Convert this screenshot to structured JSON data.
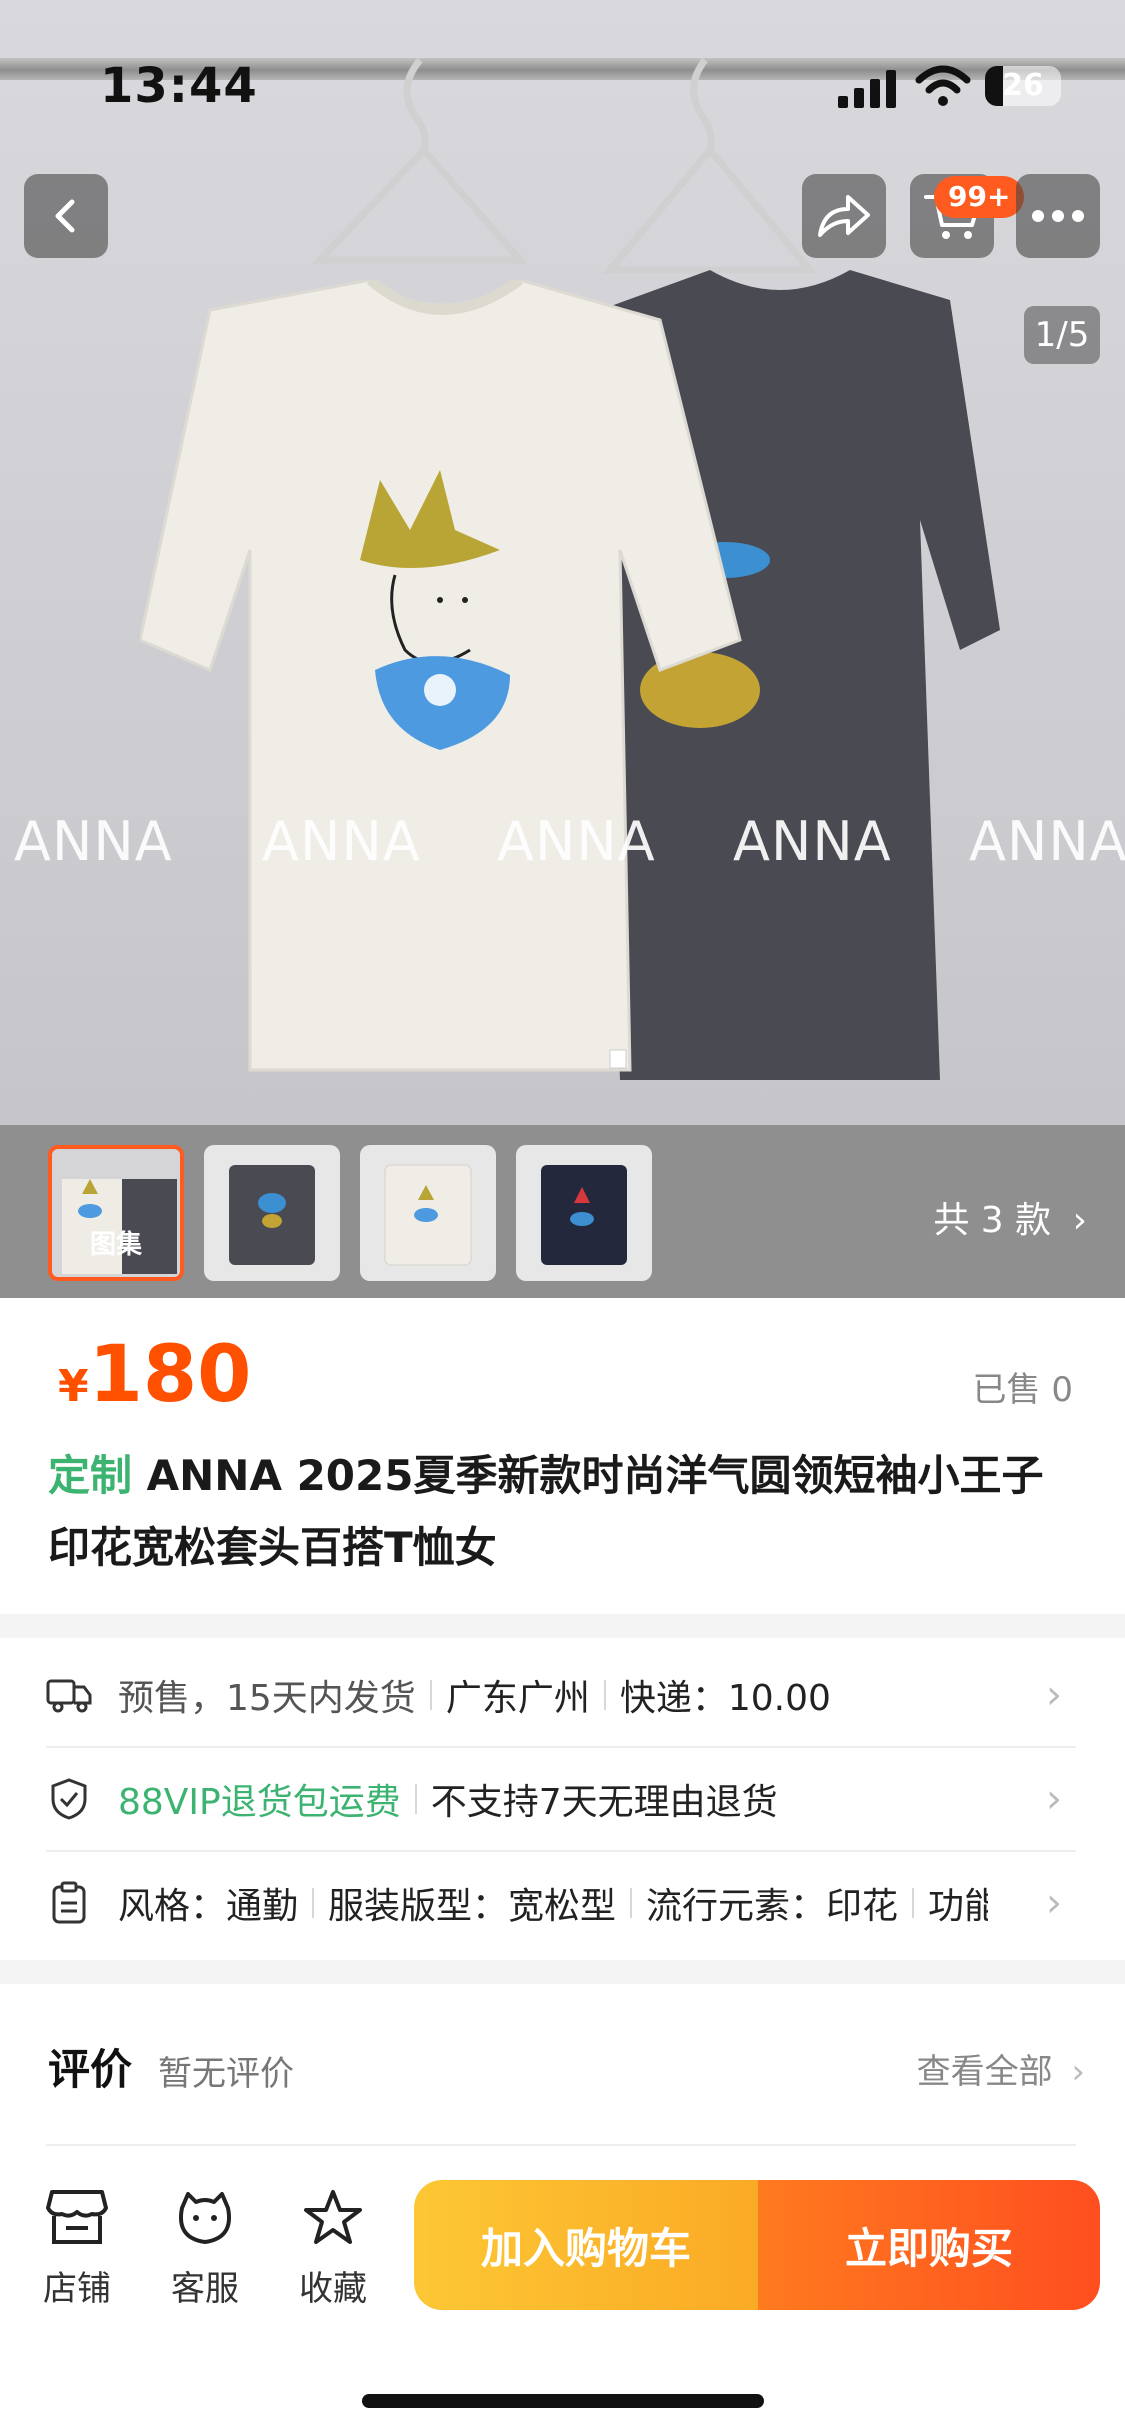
{
  "status_bar": {
    "time": "13:44",
    "battery": "26"
  },
  "nav": {
    "cart_badge": "99+",
    "image_counter": "1/5"
  },
  "watermark": [
    "ANNA",
    "ANNA",
    "ANNA",
    "ANNA",
    "ANNA"
  ],
  "gallery": {
    "first_thumb_label": "图集",
    "variants_label": "共 3 款"
  },
  "product": {
    "currency": "¥",
    "price": "180",
    "sold": "已售 0",
    "tag": "定制",
    "title": "ANNA 2025夏季新款时尚洋气圆领短袖小王子印花宽松套头百搭T恤女"
  },
  "shipping": {
    "presale": "预售，15天内发货",
    "location": "广东广州",
    "express": "快递：10.00"
  },
  "guarantee": {
    "vip": "88VIP退货包运费",
    "no_return": "不支持7天无理由退货"
  },
  "attributes": {
    "style": "风格：通勤",
    "fit": "服装版型：宽松型",
    "element": "流行元素：印花",
    "more": "功能"
  },
  "reviews": {
    "label": "评价",
    "summary": "暂无评价",
    "view_all": "查看全部"
  },
  "bottom": {
    "store": "店铺",
    "service": "客服",
    "favorite": "收藏",
    "add_to_cart": "加入购物车",
    "buy_now": "立即购买"
  },
  "colors": {
    "accent": "#ff5000",
    "green": "#3cb371",
    "cart_yellow": "#fbbb2c",
    "buy_orange": "#ff5a1f"
  }
}
